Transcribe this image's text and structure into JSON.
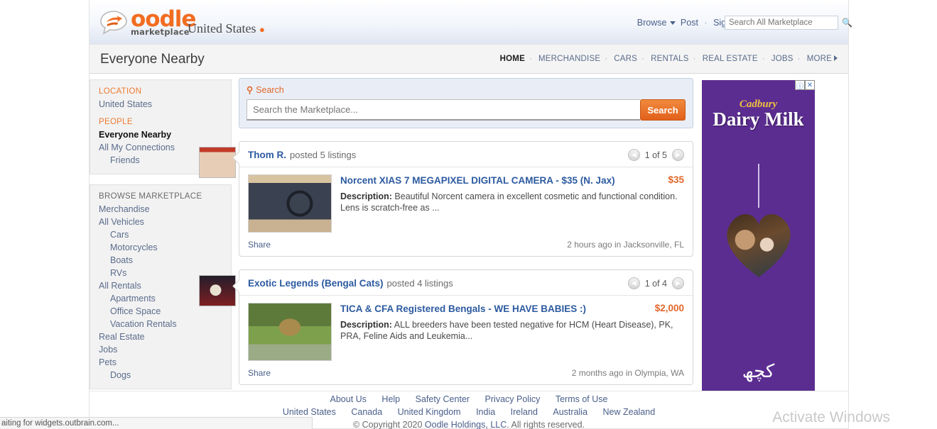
{
  "header": {
    "logo_text": "oodle",
    "logo_sub": "marketplace",
    "country": "United States",
    "pin_icon": "location-pin-icon",
    "nav": {
      "browse": "Browse",
      "post": "Post",
      "signin": "Sign In",
      "sep": "·"
    },
    "search_placeholder": "Search All Marketplace",
    "search_value": "",
    "search_icon": "search-icon"
  },
  "secondary": {
    "title": "Everyone Nearby",
    "categories": [
      {
        "label": "HOME",
        "active": true
      },
      {
        "label": "MERCHANDISE",
        "active": false
      },
      {
        "label": "CARS",
        "active": false
      },
      {
        "label": "RENTALS",
        "active": false
      },
      {
        "label": "REAL ESTATE",
        "active": false
      },
      {
        "label": "JOBS",
        "active": false
      },
      {
        "label": "MORE",
        "active": false
      }
    ],
    "dot": "·"
  },
  "sidebar": {
    "location_head": "LOCATION",
    "location_item": "United States",
    "people_head": "PEOPLE",
    "people": [
      {
        "label": "Everyone Nearby",
        "bold": true
      },
      {
        "label": "All My Connections",
        "bold": false
      },
      {
        "label": "Friends",
        "indent": true
      }
    ],
    "browse_head": "BROWSE MARKETPLACE",
    "browse": [
      {
        "label": "Merchandise",
        "indent": false
      },
      {
        "label": "All Vehicles",
        "indent": false
      },
      {
        "label": "Cars",
        "indent": true
      },
      {
        "label": "Motorcycles",
        "indent": true
      },
      {
        "label": "Boats",
        "indent": true
      },
      {
        "label": "RVs",
        "indent": true
      },
      {
        "label": "All Rentals",
        "indent": false
      },
      {
        "label": "Apartments",
        "indent": true
      },
      {
        "label": "Office Space",
        "indent": true
      },
      {
        "label": "Vacation Rentals",
        "indent": true
      },
      {
        "label": "Real Estate",
        "indent": false
      },
      {
        "label": "Jobs",
        "indent": false
      },
      {
        "label": "Pets",
        "indent": false
      },
      {
        "label": "Dogs",
        "indent": true
      }
    ]
  },
  "search_panel": {
    "label": "Search",
    "icon": "search-icon",
    "placeholder": "Search the Marketplace...",
    "value": "",
    "button": "Search"
  },
  "listings": [
    {
      "poster": "Thom R.",
      "posted_text": "posted 5 listings",
      "pager": "1 of 5",
      "prev_icon": "chevron-left-icon",
      "next_icon": "chevron-right-icon",
      "title": "Norcent XIAS 7 MEGAPIXEL DIGITAL CAMERA - $35 (N. Jax)",
      "price": "$35",
      "desc_label": "Description:",
      "desc": "Beautiful Norcent camera in excellent cosmetic and functional condition. Lens is scratch-free as ...",
      "share": "Share",
      "meta": "2 hours ago in Jacksonville, FL",
      "thumb_name": "camera-photo",
      "avatar_name": "poster-avatar"
    },
    {
      "poster": "Exotic Legends (Bengal Cats)",
      "posted_text": "posted 4 listings",
      "pager": "1 of 4",
      "prev_icon": "chevron-left-icon",
      "next_icon": "chevron-right-icon",
      "title": "TICA & CFA Registered Bengals - WE HAVE BABIES :)",
      "price": "$2,000",
      "desc_label": "Description:",
      "desc": "ALL breeders have been tested negative for HCM (Heart Disease), PK, PRA, Feline Aids and Leukemia...",
      "share": "Share",
      "meta": "2 months ago in Olympia, WA",
      "thumb_name": "bengal-cat-photo",
      "avatar_name": "poster-avatar"
    }
  ],
  "ad": {
    "brand": "Cadbury",
    "product": "Dairy Milk",
    "urdu": "کچھ",
    "info_icon": "adchoices-info-icon",
    "close_icon": "close-icon"
  },
  "footer": {
    "links": [
      "About Us",
      "Help",
      "Safety Center",
      "Privacy Policy",
      "Terms of Use"
    ],
    "countries": [
      "United States",
      "Canada",
      "United Kingdom",
      "India",
      "Ireland",
      "Australia",
      "New Zealand"
    ],
    "copyright_prefix": "© Copyright 2020 ",
    "copyright_link": "Oodle Holdings, LLC",
    "copyright_suffix": ". All rights reserved."
  },
  "browser": {
    "status": "aiting for widgets.outbrain.com...",
    "watermark": "Activate Windows"
  },
  "colors": {
    "brand_orange": "#f26c20",
    "link_blue": "#2c5aa0",
    "ad_purple": "#5b2d91"
  }
}
